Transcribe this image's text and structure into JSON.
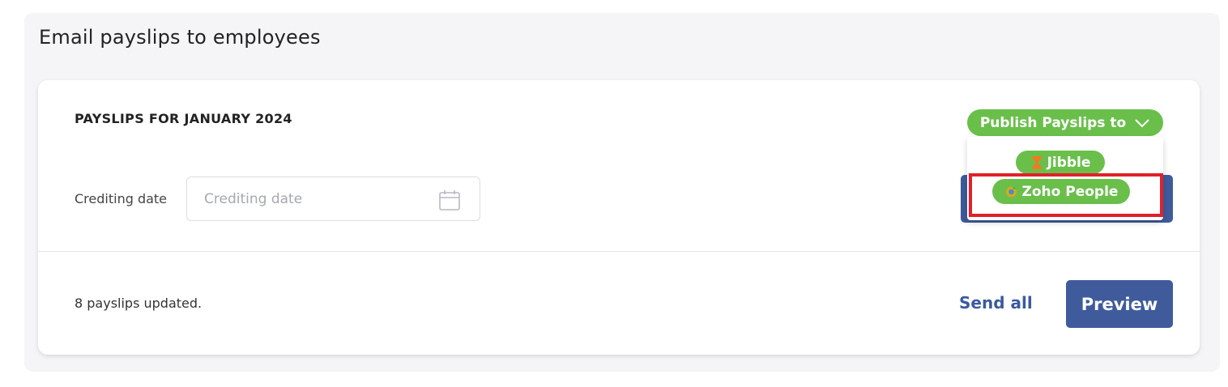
{
  "section": {
    "title": "Email payslips to employees"
  },
  "card": {
    "heading": "PAYSLIPS FOR JANUARY 2024",
    "crediting": {
      "label": "Crediting date",
      "placeholder": "Crediting date",
      "value": ""
    },
    "publish": {
      "label": "Publish Payslips to",
      "options": [
        {
          "label": "Jibble",
          "icon": "hourglass-icon",
          "icon_color": "#f07a22"
        },
        {
          "label": "Zoho People",
          "icon": "zoho-people-icon",
          "icon_color": "#d9a81e"
        }
      ],
      "highlighted_option": "Zoho People"
    },
    "status_text": "8 payslips updated.",
    "send_all_label": "Send all",
    "preview_label": "Preview"
  },
  "colors": {
    "accent_green": "#6abf4b",
    "primary_blue": "#3f5b9c",
    "link_blue": "#3a5aa0",
    "highlight_red": "#e0202a"
  }
}
